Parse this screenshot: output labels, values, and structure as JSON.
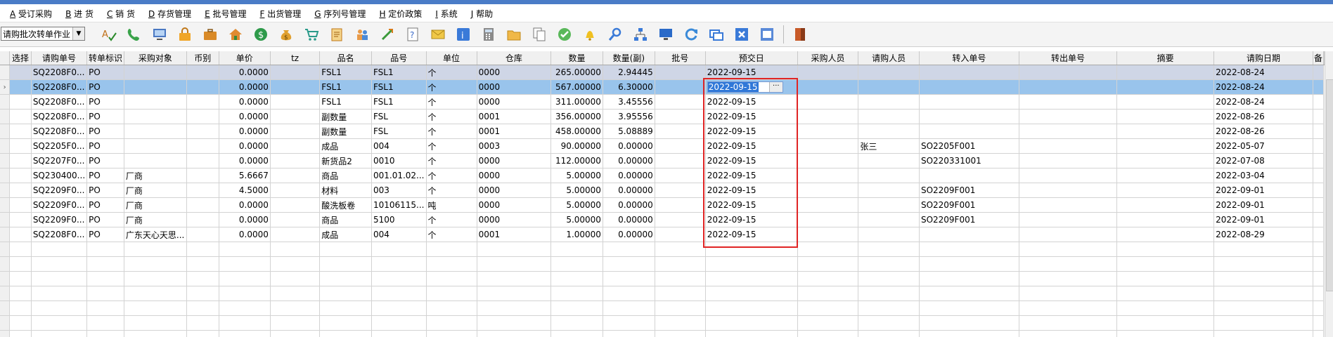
{
  "menu": [
    {
      "key": "A",
      "label": "受订采购"
    },
    {
      "key": "B",
      "label": "进 货"
    },
    {
      "key": "C",
      "label": "销 货"
    },
    {
      "key": "D",
      "label": "存货管理"
    },
    {
      "key": "E",
      "label": "批号管理"
    },
    {
      "key": "F",
      "label": "出货管理"
    },
    {
      "key": "G",
      "label": "序列号管理"
    },
    {
      "key": "H",
      "label": "定价政策"
    },
    {
      "key": "I",
      "label": "系统"
    },
    {
      "key": "J",
      "label": "帮助"
    }
  ],
  "toolbar": {
    "combo_value": "请购批次转单作业",
    "icons": [
      "spell-check-icon",
      "phone-icon",
      "computer-icon",
      "lock-icon",
      "briefcase-icon",
      "home-icon",
      "dollar-icon",
      "money-bag-icon",
      "cart-icon",
      "clipboard-icon",
      "users-icon",
      "link-icon",
      "help-doc-icon",
      "mail-icon",
      "info-icon",
      "calculator-icon",
      "folder-icon",
      "copy-icon",
      "check-icon",
      "bell-icon",
      "search-icon",
      "org-chart-icon",
      "monitor-icon",
      "refresh-icon",
      "window-icon",
      "close-icon",
      "restore-icon",
      "exit-icon"
    ]
  },
  "grid": {
    "columns": [
      "选择",
      "请购单号",
      "转单标识",
      "采购对象",
      "币别",
      "单价",
      "tz",
      "品名",
      "品号",
      "单位",
      "仓库",
      "数量",
      "数量(副)",
      "批号",
      "预交日",
      "采购人员",
      "请购人员",
      "转入单号",
      "转出单号",
      "摘要",
      "请购日期",
      "备"
    ],
    "rows": [
      [
        "",
        "SQ2208F0...",
        "PO",
        "",
        "",
        "0.0000",
        "",
        "FSL1",
        "FSL1",
        "个",
        "0000",
        "265.00000",
        "2.94445",
        "",
        "2022-09-15",
        "",
        "",
        "",
        "",
        "",
        "2022-08-24"
      ],
      [
        "",
        "SQ2208F0...",
        "PO",
        "",
        "",
        "0.0000",
        "",
        "FSL1",
        "FSL1",
        "个",
        "0000",
        "567.00000",
        "6.30000",
        "",
        "2022-09-15",
        "",
        "",
        "",
        "",
        "",
        "2022-08-24"
      ],
      [
        "",
        "SQ2208F0...",
        "PO",
        "",
        "",
        "0.0000",
        "",
        "FSL1",
        "FSL1",
        "个",
        "0000",
        "311.00000",
        "3.45556",
        "",
        "2022-09-15",
        "",
        "",
        "",
        "",
        "",
        "2022-08-24"
      ],
      [
        "",
        "SQ2208F0...",
        "PO",
        "",
        "",
        "0.0000",
        "",
        "副数量",
        "FSL",
        "个",
        "0001",
        "356.00000",
        "3.95556",
        "",
        "2022-09-15",
        "",
        "",
        "",
        "",
        "",
        "2022-08-26"
      ],
      [
        "",
        "SQ2208F0...",
        "PO",
        "",
        "",
        "0.0000",
        "",
        "副数量",
        "FSL",
        "个",
        "0001",
        "458.00000",
        "5.08889",
        "",
        "2022-09-15",
        "",
        "",
        "",
        "",
        "",
        "2022-08-26"
      ],
      [
        "",
        "SQ2205F0...",
        "PO",
        "",
        "",
        "0.0000",
        "",
        "成品",
        "004",
        "个",
        "0003",
        "90.00000",
        "0.00000",
        "",
        "2022-09-15",
        "",
        "张三",
        "SO2205F001",
        "",
        "",
        "2022-05-07"
      ],
      [
        "",
        "SQ2207F0...",
        "PO",
        "",
        "",
        "0.0000",
        "",
        "新货品2",
        "0010",
        "个",
        "0000",
        "112.00000",
        "0.00000",
        "",
        "2022-09-15",
        "",
        "",
        "SO220331001",
        "",
        "",
        "2022-07-08"
      ],
      [
        "",
        "SQ230400...",
        "PO",
        "厂商",
        "",
        "5.6667",
        "",
        "商品",
        "001.01.02...",
        "个",
        "0000",
        "5.00000",
        "0.00000",
        "",
        "2022-09-15",
        "",
        "",
        "",
        "",
        "",
        "2022-03-04"
      ],
      [
        "",
        "SQ2209F0...",
        "PO",
        "厂商",
        "",
        "4.5000",
        "",
        "材料",
        "003",
        "个",
        "0000",
        "5.00000",
        "0.00000",
        "",
        "2022-09-15",
        "",
        "",
        "SO2209F001",
        "",
        "",
        "2022-09-01"
      ],
      [
        "",
        "SQ2209F0...",
        "PO",
        "厂商",
        "",
        "0.0000",
        "",
        "酸洗板卷",
        "10106115...",
        "吨",
        "0000",
        "5.00000",
        "0.00000",
        "",
        "2022-09-15",
        "",
        "",
        "SO2209F001",
        "",
        "",
        "2022-09-01"
      ],
      [
        "",
        "SQ2209F0...",
        "PO",
        "厂商",
        "",
        "0.0000",
        "",
        "商品",
        "5100",
        "个",
        "0000",
        "5.00000",
        "0.00000",
        "",
        "2022-09-15",
        "",
        "",
        "SO2209F001",
        "",
        "",
        "2022-09-01"
      ],
      [
        "",
        "SQ2208F0...",
        "PO",
        "广东天心天思...",
        "",
        "0.0000",
        "",
        "成品",
        "004",
        "个",
        "0001",
        "1.00000",
        "0.00000",
        "",
        "2022-09-15",
        "",
        "",
        "",
        "",
        "",
        "2022-08-29"
      ]
    ],
    "selected_row": 1,
    "top_row": 0,
    "editing_value": "2022-09-15",
    "ellipsis": "···",
    "row_marker": "›",
    "empty_rows": 7
  }
}
